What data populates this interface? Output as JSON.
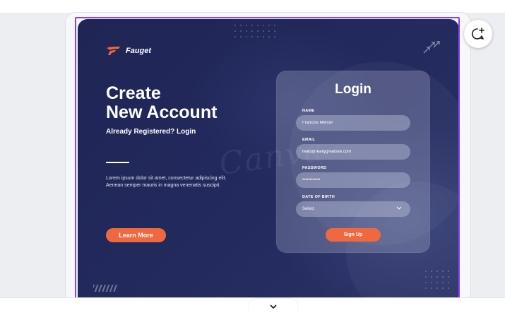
{
  "brand": {
    "name": "Fauget"
  },
  "hero": {
    "headline_line1": "Create",
    "headline_line2": "New Account",
    "subhead": "Already Registered? Login",
    "body_line1": "Lorem ipsum dolor sit amet, consectetur adipiscing elit.",
    "body_line2": "Aenean semper mauris in magna venenatis suscipit.",
    "cta_label": "Learn More"
  },
  "login": {
    "title": "Login",
    "name_label": "NAME",
    "name_value": "Francois Mercer",
    "email_label": "EMAIL",
    "email_value": "hello@reallygreatsite.com",
    "password_label": "PASSWORD",
    "password_value": "••••••••••••",
    "dob_label": "DATE OF BIRTH",
    "dob_value": "Select",
    "signup_label": "Sign Up"
  },
  "watermark": {
    "text": "Canva"
  },
  "icons": {
    "comment": "add-comment-icon",
    "chevron": "chevron-down-icon"
  },
  "colors": {
    "background_navy": "#232a5e",
    "accent_orange": "#f0683f",
    "selection_purple": "#8b3dff"
  }
}
